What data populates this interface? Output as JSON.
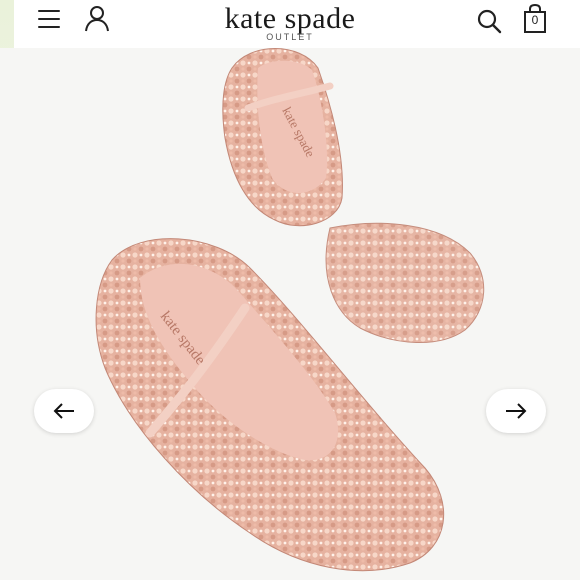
{
  "header": {
    "logo_text": "kate spade",
    "logo_sub": "OUTLET",
    "bag_count": "0"
  },
  "carousel": {
    "prev_icon": "arrow-left-icon",
    "next_icon": "arrow-right-icon"
  },
  "colors": {
    "shoe_base": "#e9b8a6",
    "shoe_shadow": "#c98f7d",
    "lining": "#f0c3b6",
    "background": "#f6f6f4"
  }
}
